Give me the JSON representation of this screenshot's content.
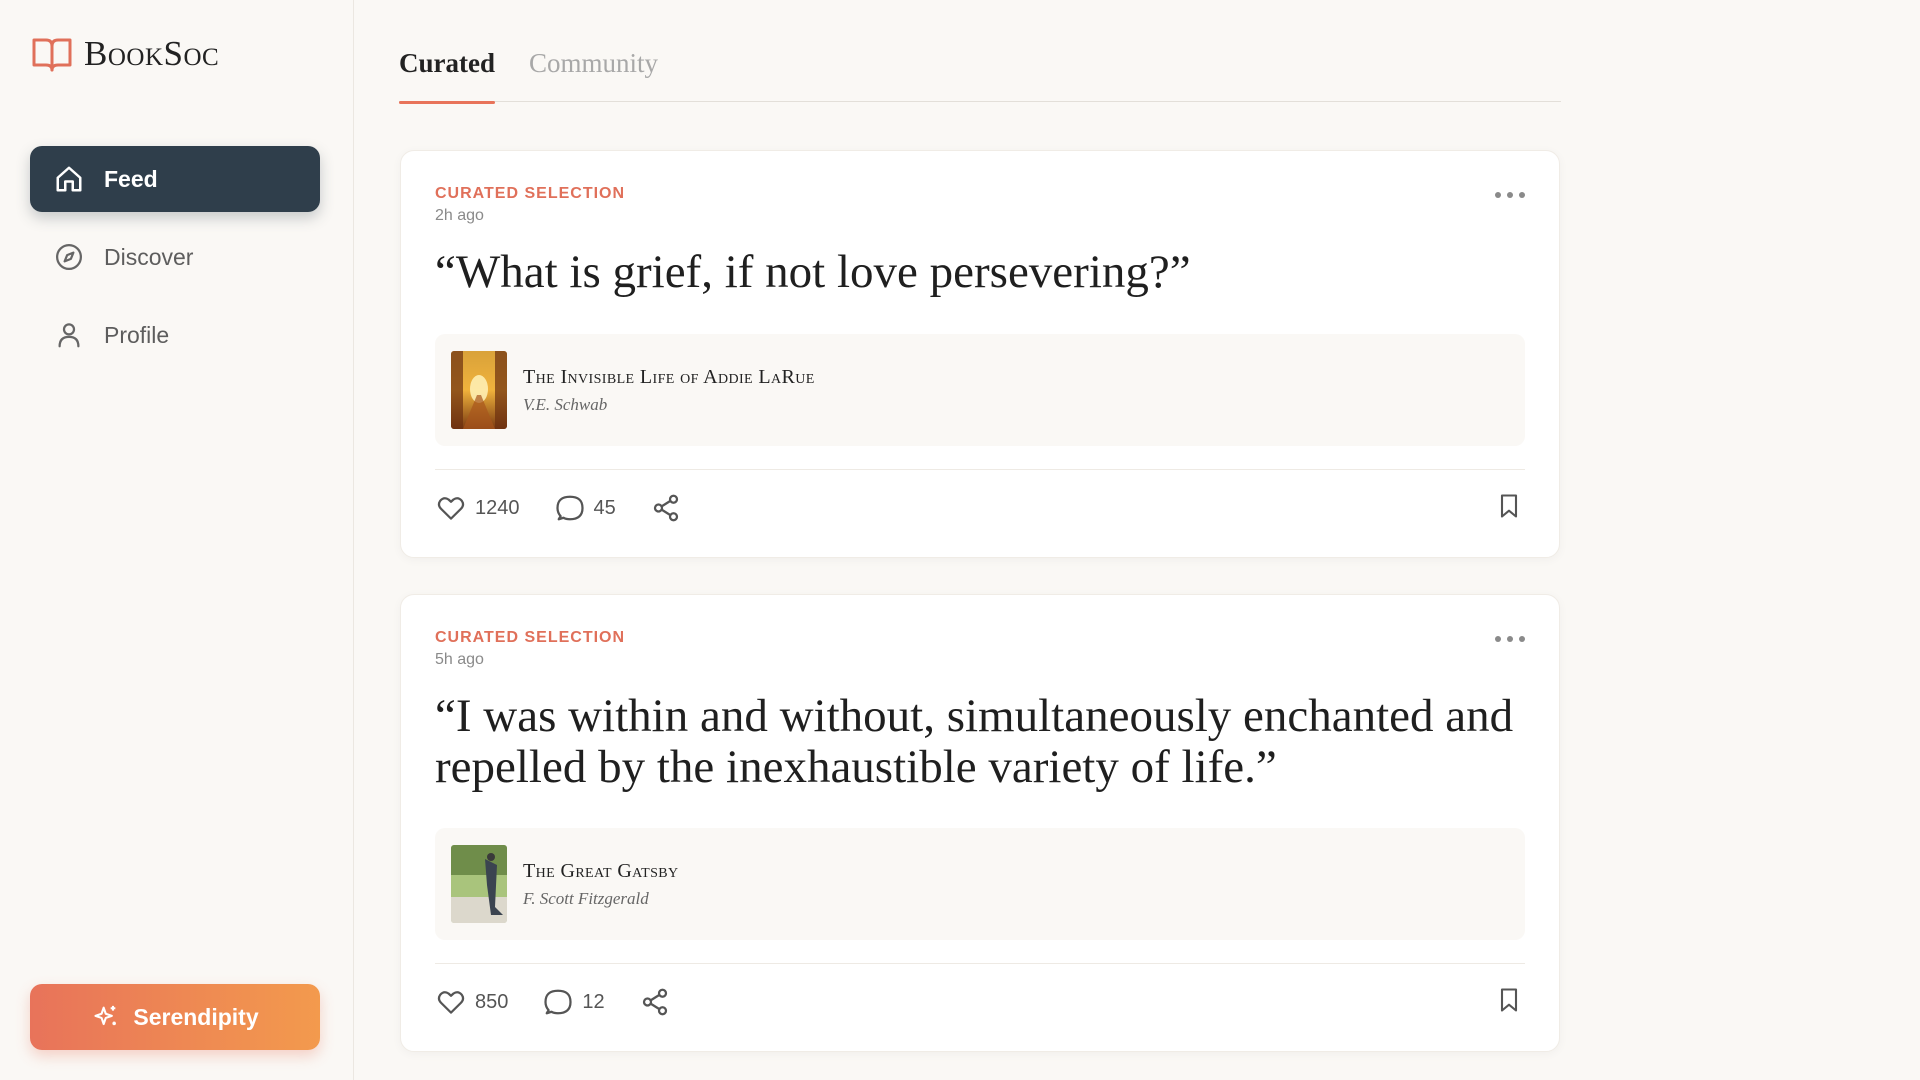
{
  "app": {
    "name": "BookSoc"
  },
  "sidebar": {
    "items": [
      {
        "label": "Feed",
        "icon": "home-icon",
        "active": true
      },
      {
        "label": "Discover",
        "icon": "compass-icon",
        "active": false
      },
      {
        "label": "Profile",
        "icon": "user-icon",
        "active": false
      }
    ],
    "serendipity_label": "Serendipity"
  },
  "tabs": [
    {
      "label": "Curated",
      "active": true
    },
    {
      "label": "Community",
      "active": false
    }
  ],
  "posts": [
    {
      "label": "CURATED SELECTION",
      "time": "2h ago",
      "quote": "“What is grief, if not love persevering?”",
      "book_title": "The Invisible Life of Addie LaRue",
      "book_author": "V.E. Schwab",
      "likes": "1240",
      "comments": "45"
    },
    {
      "label": "CURATED SELECTION",
      "time": "5h ago",
      "quote": "“I was within and without, simultaneously enchanted and repelled by the inexhaustible variety of life.”",
      "book_title": "The Great Gatsby",
      "book_author": "F. Scott Fitzgerald",
      "likes": "850",
      "comments": "12"
    }
  ],
  "colors": {
    "accent": "#e8735a",
    "nav_active": "#2f3e4b",
    "background": "#faf8f5"
  }
}
